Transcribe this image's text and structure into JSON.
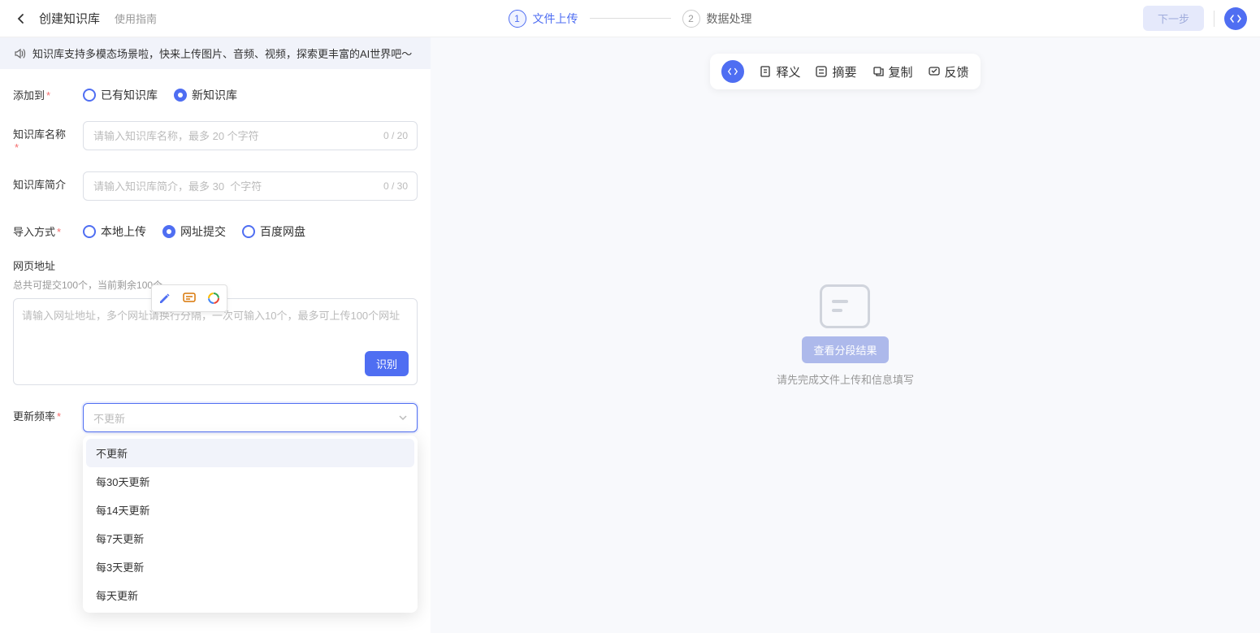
{
  "header": {
    "title": "创建知识库",
    "guide": "使用指南",
    "steps": [
      {
        "num": "1",
        "label": "文件上传",
        "active": true
      },
      {
        "num": "2",
        "label": "数据处理",
        "active": false
      }
    ],
    "next_button": "下一步"
  },
  "notice": "知识库支持多模态场景啦，快来上传图片、音频、视频，探索更丰富的AI世界吧～",
  "form": {
    "add_to": {
      "label": "添加到",
      "options": [
        "已有知识库",
        "新知识库"
      ],
      "selected": 1
    },
    "kb_name": {
      "label": "知识库名称",
      "placeholder": "请输入知识库名称，最多 20 个字符",
      "counter": "0 / 20"
    },
    "kb_intro": {
      "label": "知识库简介",
      "placeholder": "请输入知识库简介，最多 30  个字符",
      "counter": "0 / 30"
    },
    "import_method": {
      "label": "导入方式",
      "options": [
        "本地上传",
        "网址提交",
        "百度网盘"
      ],
      "selected": 1
    },
    "url_section": {
      "heading": "网页地址",
      "sub": "总共可提交100个，当前剩余100个",
      "placeholder": "请输入网址地址，多个网址请换行分隔，一次可输入10个，最多可上传100个网址",
      "recognize_btn": "识别"
    },
    "update_freq": {
      "label": "更新频率",
      "selected": "不更新",
      "options": [
        "不更新",
        "每30天更新",
        "每14天更新",
        "每7天更新",
        "每3天更新",
        "每天更新"
      ]
    }
  },
  "right": {
    "toolbar": [
      "释义",
      "摘要",
      "复制",
      "反馈"
    ],
    "view_segments": "查看分段结果",
    "empty_hint": "请先完成文件上传和信息填写"
  }
}
